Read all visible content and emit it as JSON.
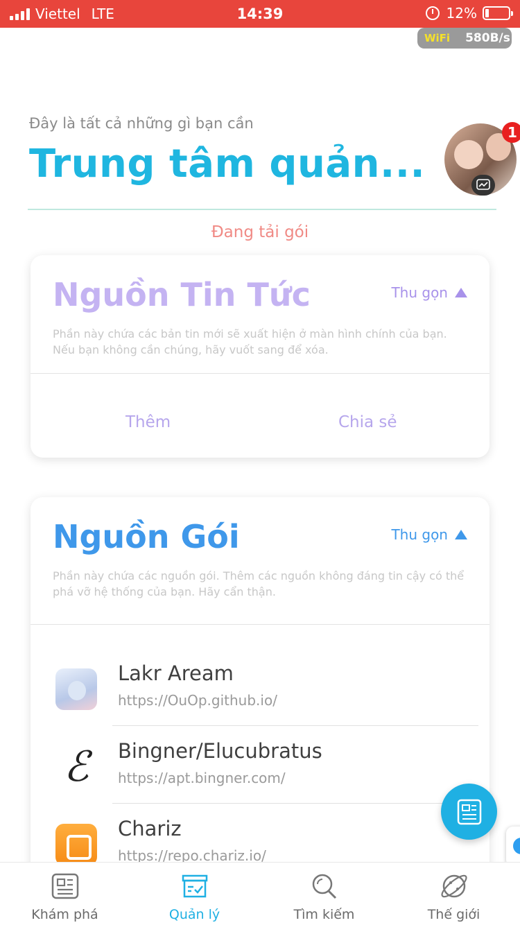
{
  "status_bar": {
    "carrier": "Viettel",
    "network": "LTE",
    "time": "14:39",
    "battery": "12%"
  },
  "wifi_badge": {
    "label": "WiFi",
    "speed": "580B/s"
  },
  "header": {
    "subtitle": "Đây là tất cả những gì bạn cần",
    "title": "Trung tâm quản..."
  },
  "loading_text": "Đang tải gói",
  "chat_head": {
    "badge_count": "1"
  },
  "news_card": {
    "title": "Nguồn Tin Tức",
    "collapse_label": "Thu gọn",
    "description": "Phần này chứa các bản tin mới sẽ xuất hiện ở màn hình chính của bạn. Nếu bạn không cần chúng, hãy vuốt sang để xóa.",
    "add_label": "Thêm",
    "share_label": "Chia sẻ"
  },
  "package_card": {
    "title": "Nguồn Gói",
    "collapse_label": "Thu gọn",
    "description": "Phần này chứa các nguồn gói. Thêm các nguồn không đáng tin cậy có thể phá vỡ hệ thống của bạn. Hãy cẩn thận.",
    "repos": [
      {
        "name": "Lakr Aream",
        "url": "https://OuOp.github.io/"
      },
      {
        "name": "Bingner/Elucubratus",
        "url": "https://apt.bingner.com/",
        "icon_glyph": "ℰ"
      },
      {
        "name": "Chariz",
        "url": "https://repo.chariz.io/"
      }
    ]
  },
  "tabs": [
    {
      "label": "Khám phá",
      "icon": "newspaper-icon"
    },
    {
      "label": "Quản lý",
      "icon": "manage-box-icon"
    },
    {
      "label": "Tìm kiếm",
      "icon": "search-icon"
    },
    {
      "label": "Thế giới",
      "icon": "planet-icon"
    }
  ],
  "colors": {
    "accent": "#1fb6e0",
    "status_bar": "#e8453c",
    "news_title": "#c4b3f2",
    "package_title": "#3f98ea",
    "loading": "#f08a85"
  }
}
